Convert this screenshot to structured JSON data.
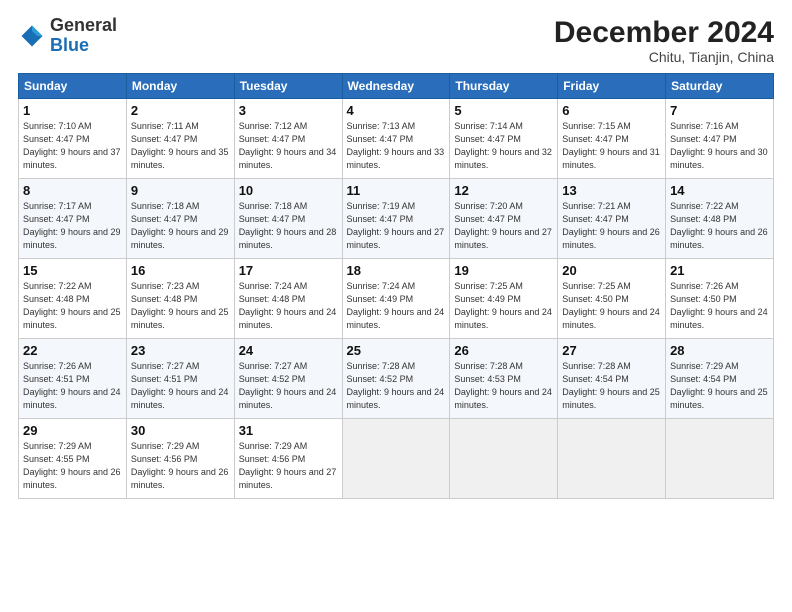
{
  "logo": {
    "general": "General",
    "blue": "Blue"
  },
  "header": {
    "month": "December 2024",
    "location": "Chitu, Tianjin, China"
  },
  "weekdays": [
    "Sunday",
    "Monday",
    "Tuesday",
    "Wednesday",
    "Thursday",
    "Friday",
    "Saturday"
  ],
  "weeks": [
    [
      {
        "day": "1",
        "sunrise": "7:10 AM",
        "sunset": "4:47 PM",
        "daylight": "9 hours and 37 minutes."
      },
      {
        "day": "2",
        "sunrise": "7:11 AM",
        "sunset": "4:47 PM",
        "daylight": "9 hours and 35 minutes."
      },
      {
        "day": "3",
        "sunrise": "7:12 AM",
        "sunset": "4:47 PM",
        "daylight": "9 hours and 34 minutes."
      },
      {
        "day": "4",
        "sunrise": "7:13 AM",
        "sunset": "4:47 PM",
        "daylight": "9 hours and 33 minutes."
      },
      {
        "day": "5",
        "sunrise": "7:14 AM",
        "sunset": "4:47 PM",
        "daylight": "9 hours and 32 minutes."
      },
      {
        "day": "6",
        "sunrise": "7:15 AM",
        "sunset": "4:47 PM",
        "daylight": "9 hours and 31 minutes."
      },
      {
        "day": "7",
        "sunrise": "7:16 AM",
        "sunset": "4:47 PM",
        "daylight": "9 hours and 30 minutes."
      }
    ],
    [
      {
        "day": "8",
        "sunrise": "7:17 AM",
        "sunset": "4:47 PM",
        "daylight": "9 hours and 29 minutes."
      },
      {
        "day": "9",
        "sunrise": "7:18 AM",
        "sunset": "4:47 PM",
        "daylight": "9 hours and 29 minutes."
      },
      {
        "day": "10",
        "sunrise": "7:18 AM",
        "sunset": "4:47 PM",
        "daylight": "9 hours and 28 minutes."
      },
      {
        "day": "11",
        "sunrise": "7:19 AM",
        "sunset": "4:47 PM",
        "daylight": "9 hours and 27 minutes."
      },
      {
        "day": "12",
        "sunrise": "7:20 AM",
        "sunset": "4:47 PM",
        "daylight": "9 hours and 27 minutes."
      },
      {
        "day": "13",
        "sunrise": "7:21 AM",
        "sunset": "4:47 PM",
        "daylight": "9 hours and 26 minutes."
      },
      {
        "day": "14",
        "sunrise": "7:22 AM",
        "sunset": "4:48 PM",
        "daylight": "9 hours and 26 minutes."
      }
    ],
    [
      {
        "day": "15",
        "sunrise": "7:22 AM",
        "sunset": "4:48 PM",
        "daylight": "9 hours and 25 minutes."
      },
      {
        "day": "16",
        "sunrise": "7:23 AM",
        "sunset": "4:48 PM",
        "daylight": "9 hours and 25 minutes."
      },
      {
        "day": "17",
        "sunrise": "7:24 AM",
        "sunset": "4:48 PM",
        "daylight": "9 hours and 24 minutes."
      },
      {
        "day": "18",
        "sunrise": "7:24 AM",
        "sunset": "4:49 PM",
        "daylight": "9 hours and 24 minutes."
      },
      {
        "day": "19",
        "sunrise": "7:25 AM",
        "sunset": "4:49 PM",
        "daylight": "9 hours and 24 minutes."
      },
      {
        "day": "20",
        "sunrise": "7:25 AM",
        "sunset": "4:50 PM",
        "daylight": "9 hours and 24 minutes."
      },
      {
        "day": "21",
        "sunrise": "7:26 AM",
        "sunset": "4:50 PM",
        "daylight": "9 hours and 24 minutes."
      }
    ],
    [
      {
        "day": "22",
        "sunrise": "7:26 AM",
        "sunset": "4:51 PM",
        "daylight": "9 hours and 24 minutes."
      },
      {
        "day": "23",
        "sunrise": "7:27 AM",
        "sunset": "4:51 PM",
        "daylight": "9 hours and 24 minutes."
      },
      {
        "day": "24",
        "sunrise": "7:27 AM",
        "sunset": "4:52 PM",
        "daylight": "9 hours and 24 minutes."
      },
      {
        "day": "25",
        "sunrise": "7:28 AM",
        "sunset": "4:52 PM",
        "daylight": "9 hours and 24 minutes."
      },
      {
        "day": "26",
        "sunrise": "7:28 AM",
        "sunset": "4:53 PM",
        "daylight": "9 hours and 24 minutes."
      },
      {
        "day": "27",
        "sunrise": "7:28 AM",
        "sunset": "4:54 PM",
        "daylight": "9 hours and 25 minutes."
      },
      {
        "day": "28",
        "sunrise": "7:29 AM",
        "sunset": "4:54 PM",
        "daylight": "9 hours and 25 minutes."
      }
    ],
    [
      {
        "day": "29",
        "sunrise": "7:29 AM",
        "sunset": "4:55 PM",
        "daylight": "9 hours and 26 minutes."
      },
      {
        "day": "30",
        "sunrise": "7:29 AM",
        "sunset": "4:56 PM",
        "daylight": "9 hours and 26 minutes."
      },
      {
        "day": "31",
        "sunrise": "7:29 AM",
        "sunset": "4:56 PM",
        "daylight": "9 hours and 27 minutes."
      },
      null,
      null,
      null,
      null
    ]
  ]
}
